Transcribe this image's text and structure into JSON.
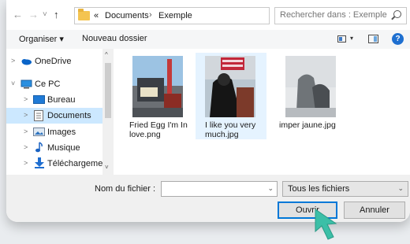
{
  "address": {
    "back": "←",
    "forward": "→",
    "recent": "˅",
    "up": "↑",
    "overflow": "«",
    "crumbs": [
      "Documents",
      "Exemple"
    ],
    "separator": "›",
    "dropdown": "⌄",
    "refresh": "↻"
  },
  "search": {
    "placeholder": "Rechercher dans : Exemple"
  },
  "toolbar": {
    "organize": "Organiser ▾",
    "new_folder": "Nouveau dossier",
    "help": "?",
    "view_dropdown": "▾"
  },
  "nav": {
    "items": [
      {
        "label": "OneDrive",
        "chevron": ">",
        "icon": "cloud-icon"
      },
      {
        "label": "Ce PC",
        "chevron": "˅",
        "icon": "computer-icon"
      },
      {
        "label": "Bureau",
        "chevron": ">",
        "icon": "desktop-icon"
      },
      {
        "label": "Documents",
        "chevron": ">",
        "icon": "documents-icon",
        "selected": true
      },
      {
        "label": "Images",
        "chevron": ">",
        "icon": "images-icon"
      },
      {
        "label": "Musique",
        "chevron": ">",
        "icon": "music-icon"
      },
      {
        "label": "Téléchargement",
        "chevron": ">",
        "icon": "download-icon"
      }
    ],
    "scroll_up": "^",
    "scroll_down": "˅"
  },
  "files": [
    {
      "name": "Fried Egg I'm In love.png",
      "selected": false
    },
    {
      "name": "I like you very much.jpg",
      "selected": true
    },
    {
      "name": "imper jaune.jpg",
      "selected": false
    }
  ],
  "footer": {
    "filename_label": "Nom du fichier :",
    "filename_value": "",
    "filename_drop": "⌄",
    "filetype": "Tous les fichiers",
    "filetype_drop": "⌄",
    "open": "Ouvrir",
    "cancel": "Annuler"
  },
  "colors": {
    "accent": "#0078d7",
    "selection": "#cce8ff",
    "cursor": "#3bbfa7"
  }
}
